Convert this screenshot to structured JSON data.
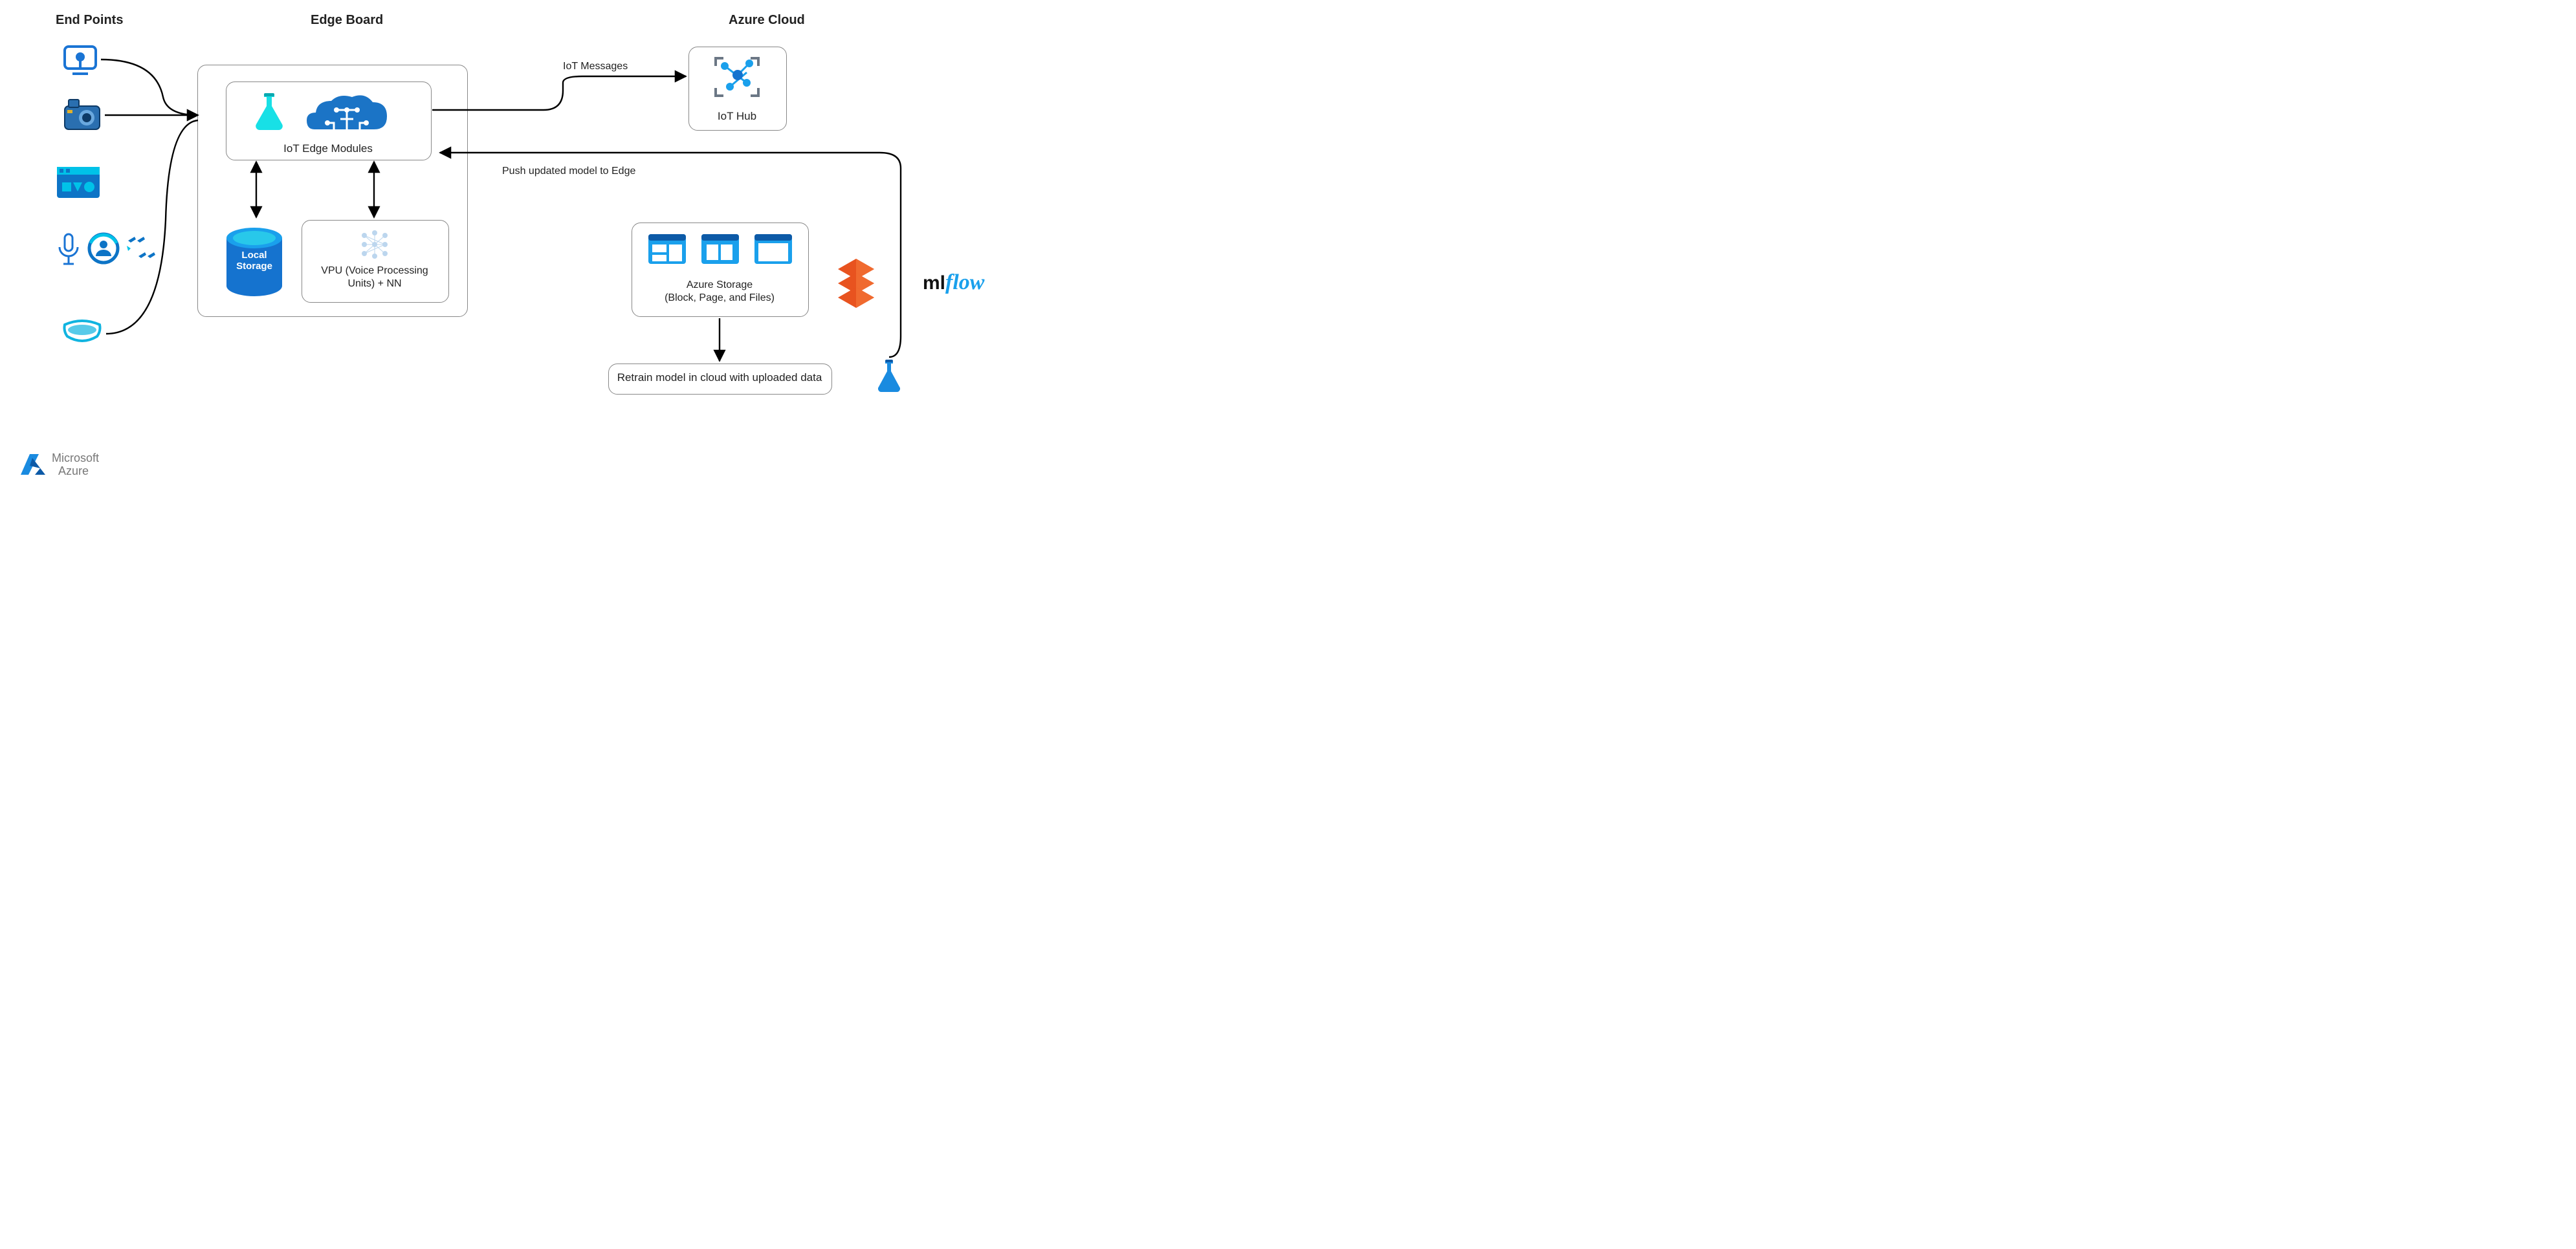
{
  "headers": {
    "endpoints": "End Points",
    "edgeboard": "Edge Board",
    "azurecloud": "Azure Cloud"
  },
  "edge": {
    "iot_modules": "IoT Edge Modules",
    "local_storage": "Local\nStorage",
    "vpu1": "VPU (Voice Processing",
    "vpu2": "Units) + NN"
  },
  "cloud": {
    "iot_hub": "IoT Hub",
    "storage1": "Azure Storage",
    "storage2": "(Block, Page, and Files)",
    "retrain": "Retrain model in cloud with uploaded data"
  },
  "arrows": {
    "iot_messages": "IoT Messages",
    "push_model": "Push updated model to Edge"
  },
  "logos": {
    "ms": "Microsoft",
    "az": "Azure",
    "mlflow_ml": "ml",
    "mlflow_flow": "flow"
  }
}
